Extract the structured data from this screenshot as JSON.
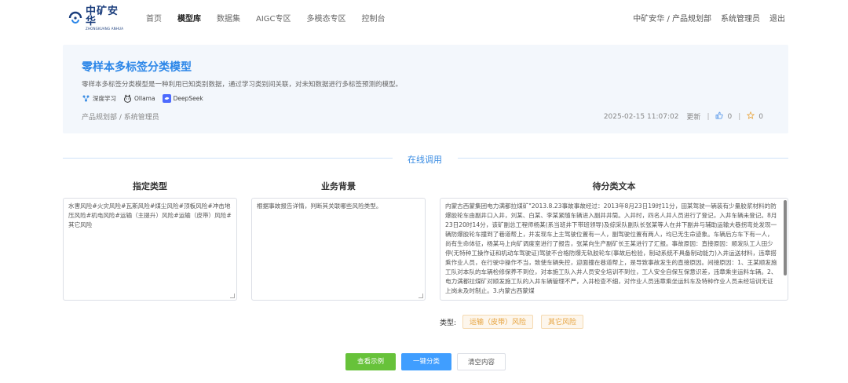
{
  "header": {
    "logo_cn": "中矿安华",
    "logo_en": "ZHONGKUANG ANHUA",
    "nav": [
      "首页",
      "模型库",
      "数据集",
      "AIGC专区",
      "多模态专区",
      "控制台"
    ],
    "active_nav_index": 1,
    "user_org": "中矿安华 / 产品规划部",
    "user_name": "系统管理员",
    "logout": "退出"
  },
  "model": {
    "title": "零样本多标签分类模型",
    "description": "零样本多标签分类模型是一种利用已知类别数据，通过学习类别间关联，对未知数据进行多标签预测的模型。",
    "tags": [
      {
        "label": "深度学习",
        "icon": "deep-learning-icon"
      },
      {
        "label": "Ollama",
        "icon": "ollama-icon"
      },
      {
        "label": "DeepSeek",
        "icon": "deepseek-icon"
      }
    ],
    "org": "产品规划部 / 系统管理员",
    "updated_time": "2025-02-15 11:07:02",
    "updated_label": "更新",
    "likes": "0",
    "stars": "0"
  },
  "section": {
    "title": "在线调用"
  },
  "columns": {
    "labels_head": "指定类型",
    "background_head": "业务背景",
    "text_head": "待分类文本"
  },
  "inputs": {
    "labels_value": "水害风险#火灾风险#瓦斯风险#煤尘风险#顶板风险#冲击地压风险#机电风险#运输（主提升）风险#运输（皮带）风险#其它风险",
    "background_value": "根据事故报告详情，判断其关联哪些风险类型。",
    "text_value": "内蒙古西蒙集团电力满都拉煤矿\"2013.8.23事故事故经过：2013年8月23日19时11分，田某驾驶一辆装有少量胶浆材料的防爆胶轮车由副井口入井，刘某、白某、李某紧随车辆进入副井井筒。入井时，四名人井人员进行了登记，入井车辆未登记。8月23日20时14分，该矿副总工程师杨某(系当班井下带班领导)及综采队副队长张某等人在井下副井与辅助运输大巷拐弯处发现一辆防爆胶轮车撞到了巷道帮上，并发现车上主驾驶位置有一人，副驾驶位置有两人，均已无生命迹象。车辆后方车下有一人，尚有生命体征，杨某马上向矿调度室进行了报告，张某向生产副矿长王某进行了汇报。事故原因：直接原因：顺发队工人田少停(无特种工操作证和机动车驾驶证)驾驶不合格防爆无轨胶轮车(事故后检验，制动系统不具备制动能力)入井运送材料，违章搭乘作业人员，在行驶中操作不当，致使车辆失控，迎面撞在巷道帮上，是导致事故发生的直接原因。间接原因：1、王某顺发施工队对本队的车辆检修保养不到位，对本施工队入井人员安全培训不到位，工人安全自保互保意识差，违章乘坐运料车辆。2、电力满都拉煤矿对顺发施工队的入井车辆管理不严，入井检查不细，对作业人员违章乘坐运料车及特种作业人员未经培训无证上岗未及时制止。3.内蒙古西蒙煤"
  },
  "result": {
    "label": "类型:",
    "types": [
      "运输（皮带）风险",
      "其它风险"
    ]
  },
  "buttons": {
    "example": "查看示例",
    "classify": "一键分类",
    "clear": "清空内容"
  },
  "colors": {
    "accent": "#409eff",
    "title_blue": "#2b86e8",
    "green": "#67c23a",
    "warning": "#e6a23c"
  }
}
